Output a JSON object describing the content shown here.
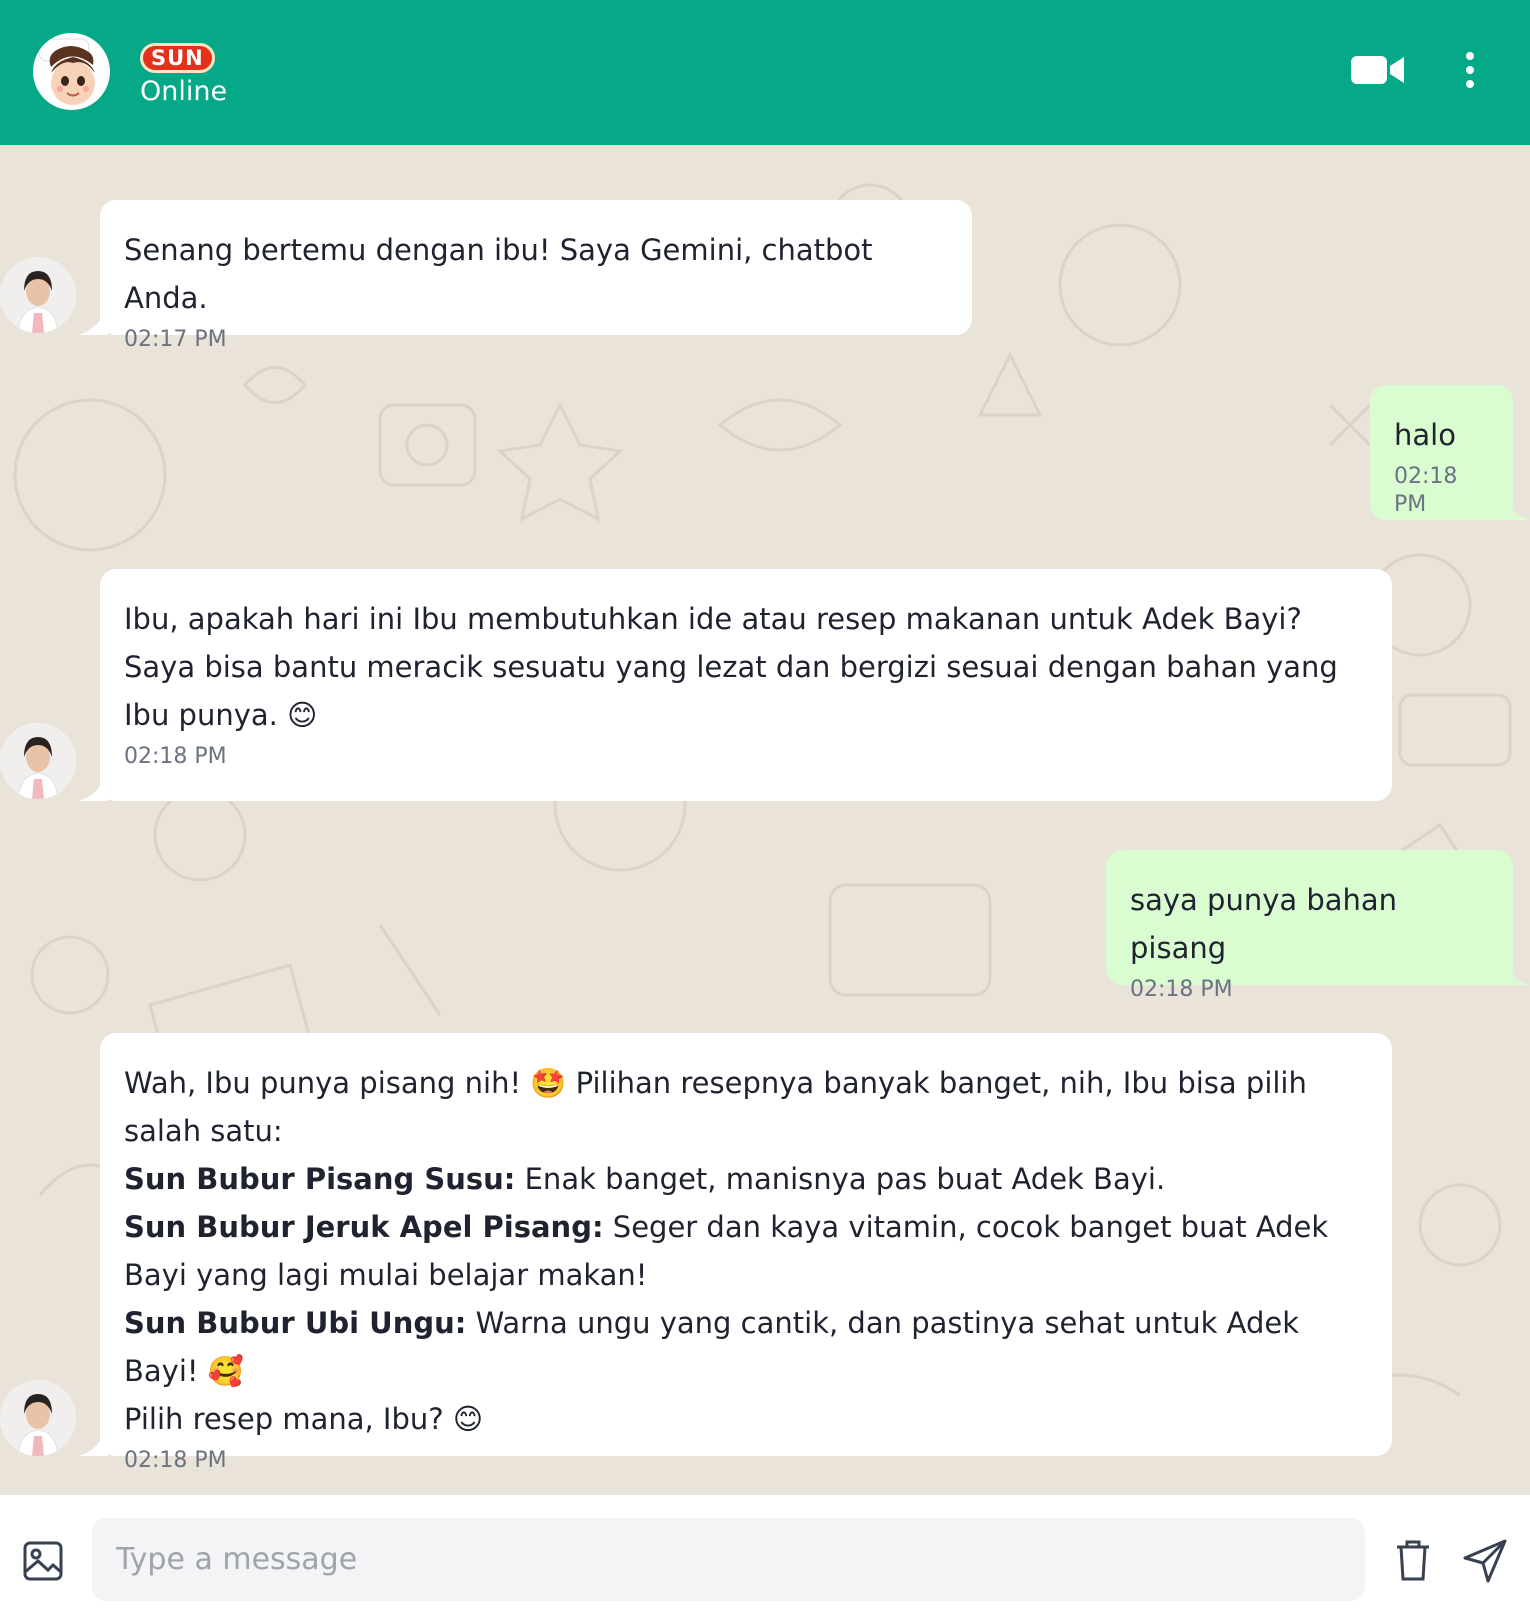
{
  "header": {
    "brand": "SUN",
    "status": "Online",
    "colors": {
      "bar": "#05a987",
      "badge": "#e3321c"
    },
    "icons": [
      "baby-mascot-avatar",
      "video-camera-icon",
      "more-vertical-icon"
    ]
  },
  "messages": [
    {
      "side": "in",
      "text": "Senang bertemu dengan ibu! Saya Gemini, chatbot Anda.",
      "time": "02:17 PM"
    },
    {
      "side": "out",
      "text": "halo",
      "time": "02:18 PM"
    },
    {
      "side": "in",
      "text": "Ibu, apakah hari ini Ibu membutuhkan ide atau resep makanan untuk Adek Bayi? Saya bisa bantu meracik sesuatu yang lezat dan bergizi sesuai dengan bahan yang Ibu punya. 😊",
      "time": "02:18 PM"
    },
    {
      "side": "out",
      "text": "saya punya bahan pisang",
      "time": "02:18 PM"
    },
    {
      "side": "in",
      "intro": "Wah, Ibu punya pisang nih! 🤩 Pilihan resepnya banyak banget, nih, Ibu bisa pilih salah satu:",
      "items": [
        {
          "name": "Sun Bubur Pisang Susu:",
          "desc": "Enak banget, manisnya pas buat Adek Bayi."
        },
        {
          "name": "Sun Bubur Jeruk Apel Pisang:",
          "desc": "Seger dan kaya vitamin, cocok banget buat Adek Bayi yang lagi mulai belajar makan!"
        },
        {
          "name": "Sun Bubur Ubi Ungu:",
          "desc": "Warna ungu yang cantik, dan pastinya sehat untuk Adek Bayi! 🥰"
        }
      ],
      "outro": "Pilih resep mana, Ibu? 😊",
      "time": "02:18 PM"
    }
  ],
  "composer": {
    "placeholder": "Type a message",
    "icons": [
      "image-icon",
      "trash-icon",
      "send-icon"
    ]
  },
  "colors": {
    "chat_bg": "#eae3d9",
    "incoming": "#ffffff",
    "outgoing": "#dafcd1"
  }
}
